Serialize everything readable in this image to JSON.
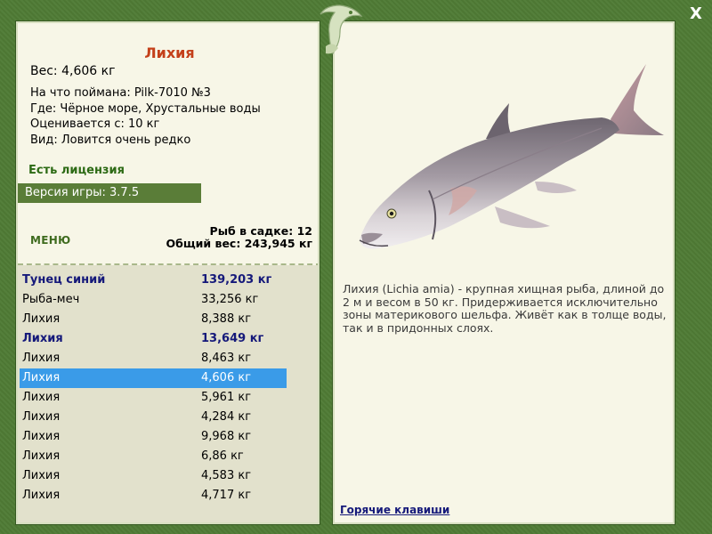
{
  "title": "Лихия",
  "weight_line": "Вес: 4,606 кг",
  "info": [
    "На что поймана: Pilk-7010 №3",
    "Где: Чёрное море, Хрустальные воды",
    "Оценивается с: 10 кг",
    "Вид: Ловится очень редко"
  ],
  "license": "Есть лицензия",
  "version": "Версия игры: 3.7.5",
  "menu_label": "МЕНЮ",
  "keep": {
    "count": "Рыб в садке: 12",
    "total": "Общий вес: 243,945 кг"
  },
  "catches": [
    {
      "name": "Тунец синий",
      "weight": "139,203 кг",
      "bold": true,
      "selected": false
    },
    {
      "name": "Рыба-меч",
      "weight": "33,256 кг",
      "bold": false,
      "selected": false
    },
    {
      "name": "Лихия",
      "weight": "8,388 кг",
      "bold": false,
      "selected": false
    },
    {
      "name": "Лихия",
      "weight": "13,649 кг",
      "bold": true,
      "selected": false
    },
    {
      "name": "Лихия",
      "weight": "8,463 кг",
      "bold": false,
      "selected": false
    },
    {
      "name": "Лихия",
      "weight": "4,606 кг",
      "bold": false,
      "selected": true
    },
    {
      "name": "Лихия",
      "weight": "5,961 кг",
      "bold": false,
      "selected": false
    },
    {
      "name": "Лихия",
      "weight": "4,284 кг",
      "bold": false,
      "selected": false
    },
    {
      "name": "Лихия",
      "weight": "9,968 кг",
      "bold": false,
      "selected": false
    },
    {
      "name": "Лихия",
      "weight": "6,86 кг",
      "bold": false,
      "selected": false
    },
    {
      "name": "Лихия",
      "weight": "4,583 кг",
      "bold": false,
      "selected": false
    },
    {
      "name": "Лихия",
      "weight": "4,717 кг",
      "bold": false,
      "selected": false
    }
  ],
  "description": "Лихия (Lichia amia) - крупная хищная рыба, длиной до 2 м и весом в 50 кг. Придерживается исключительно зоны материкового шельфа. Живёт как в толще воды, так и в придонных слоях.",
  "hotkeys_label": "Горячие клавиши",
  "close_symbol": "X",
  "colors": {
    "frame": "#4f7b35",
    "panel": "#f7f6e7",
    "title": "#c4401a",
    "license": "#2c6a14",
    "selected_row": "#3a9be8",
    "bold_row": "#15197a"
  },
  "icons": {
    "close": "close-icon",
    "emblem": "fish-emblem-icon",
    "fish_image": "lichia-fish-image"
  }
}
